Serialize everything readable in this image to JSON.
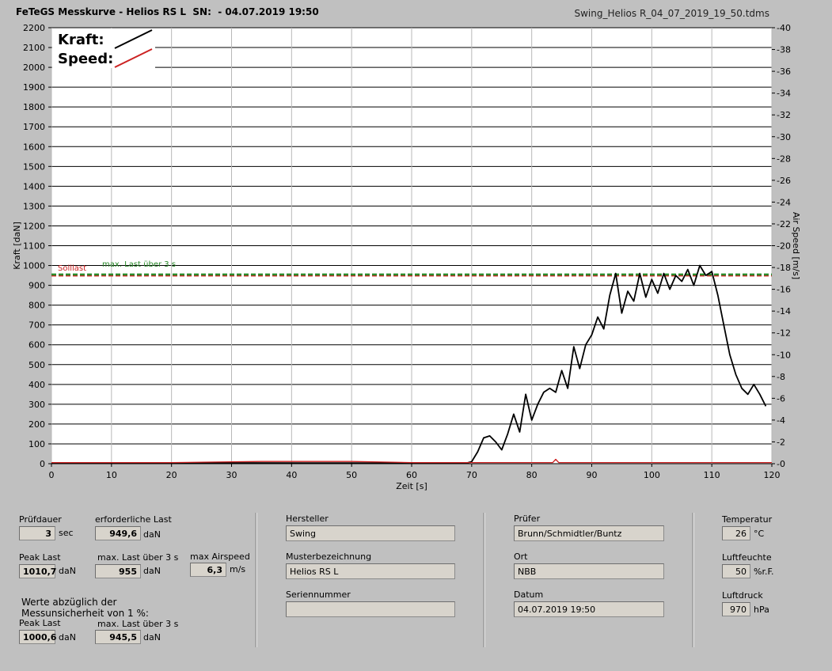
{
  "header": {
    "title": "FeTeGS Messkurve - Helios RS L  SN:  - 04.07.2019 19:50",
    "file": "Swing_Helios R_04_07_2019_19_50.tdms"
  },
  "chart_data": {
    "type": "line",
    "xlabel": "Zeit [s]",
    "ylabel_left": "Kraft [daN]",
    "ylabel_right": "Air Speed [m/s]",
    "xlim": [
      0,
      120
    ],
    "ylim_left": [
      0,
      2200
    ],
    "ylim_right": [
      0,
      40
    ],
    "x_ticks": [
      "0",
      "10",
      "20",
      "30",
      "40",
      "50",
      "60",
      "70",
      "80",
      "90",
      "100",
      "110",
      "120"
    ],
    "y_ticks_left": [
      "0",
      "100",
      "200",
      "300",
      "400",
      "500",
      "600",
      "700",
      "800",
      "900",
      "1000",
      "1100",
      "1200",
      "1300",
      "1400",
      "1500",
      "1600",
      "1700",
      "1800",
      "1900",
      "2000",
      "2100",
      "2200"
    ],
    "y_ticks_right": [
      "0",
      "2",
      "4",
      "6",
      "8",
      "10",
      "12",
      "14",
      "16",
      "18",
      "20",
      "22",
      "24",
      "26",
      "28",
      "30",
      "32",
      "34",
      "36",
      "38",
      "40"
    ],
    "grid": true,
    "legend": [
      {
        "name": "Kraft:",
        "color": "#000000"
      },
      {
        "name": "Speed:",
        "color": "#cc2222"
      }
    ],
    "reference_lines": [
      {
        "name": "Solllast",
        "value": 949.6,
        "color": "#cc2222"
      },
      {
        "name": "max. Last über  3 s",
        "value": 955,
        "color": "#2a8a2a"
      }
    ],
    "series": [
      {
        "name": "Kraft:",
        "color": "#000000",
        "x": [
          0,
          10,
          30,
          50,
          69,
          70,
          71,
          72,
          73,
          74,
          75,
          76,
          77,
          78,
          79,
          80,
          81,
          82,
          83,
          84,
          85,
          86,
          87,
          88,
          89,
          90,
          91,
          92,
          93,
          94,
          95,
          96,
          97,
          98,
          99,
          100,
          101,
          102,
          103,
          104,
          105,
          106,
          107,
          108,
          109,
          110,
          111,
          112,
          113,
          114,
          115,
          116,
          117,
          118,
          119
        ],
        "y": [
          3,
          2,
          4,
          3,
          2,
          10,
          60,
          130,
          140,
          110,
          70,
          150,
          250,
          160,
          350,
          220,
          300,
          360,
          380,
          360,
          470,
          380,
          590,
          480,
          600,
          650,
          740,
          680,
          850,
          960,
          760,
          870,
          820,
          960,
          840,
          930,
          860,
          960,
          880,
          950,
          920,
          980,
          900,
          1000,
          950,
          970,
          850,
          700,
          550,
          450,
          380,
          350,
          400,
          350,
          290
        ]
      },
      {
        "name": "Speed:",
        "color": "#cc2222",
        "x": [
          0,
          20,
          35,
          50,
          60,
          70,
          83.5,
          84,
          84.5,
          100,
          110,
          120
        ],
        "y": [
          0.1,
          0.1,
          0.2,
          0.2,
          0.1,
          0.1,
          0.1,
          0.4,
          0.1,
          0.1,
          0.1,
          0.1
        ]
      }
    ]
  },
  "panel": {
    "pruefdauer": {
      "label": "Prüfdauer",
      "value": "3",
      "unit": "sec"
    },
    "erforderliche_last": {
      "label": "erforderliche Last",
      "value": "949,6",
      "unit": "daN"
    },
    "peak_last": {
      "label": "Peak Last",
      "value": "1010,7",
      "unit": "daN"
    },
    "max_last": {
      "label": "max. Last über  3 s",
      "value": "955",
      "unit": "daN"
    },
    "max_airspeed": {
      "label": "max Airspeed",
      "value": "6,3",
      "unit": "m/s"
    },
    "werte_note_1": "Werte abzüglich der",
    "werte_note_2": "Messunsicherheit von 1  %:",
    "peak_last_corr": {
      "label": "Peak Last",
      "value": "1000,6",
      "unit": "daN"
    },
    "max_last_corr": {
      "label": "max. Last über  3 s",
      "value": "945,5",
      "unit": "daN"
    },
    "hersteller": {
      "label": "Hersteller",
      "value": "Swing"
    },
    "musterbezeichnung": {
      "label": "Musterbezeichnung",
      "value": "Helios RS L"
    },
    "seriennummer": {
      "label": "Seriennummer",
      "value": ""
    },
    "pruefer": {
      "label": "Prüfer",
      "value": "Brunn/Schmidtler/Buntz"
    },
    "ort": {
      "label": "Ort",
      "value": "NBB"
    },
    "datum": {
      "label": "Datum",
      "value": "04.07.2019 19:50"
    },
    "temperatur": {
      "label": "Temperatur",
      "value": "26",
      "unit": "°C"
    },
    "luftfeuchte": {
      "label": "Luftfeuchte",
      "value": "50",
      "unit": "%r.F."
    },
    "luftdruck": {
      "label": "Luftdruck",
      "value": "970",
      "unit": "hPa"
    }
  }
}
